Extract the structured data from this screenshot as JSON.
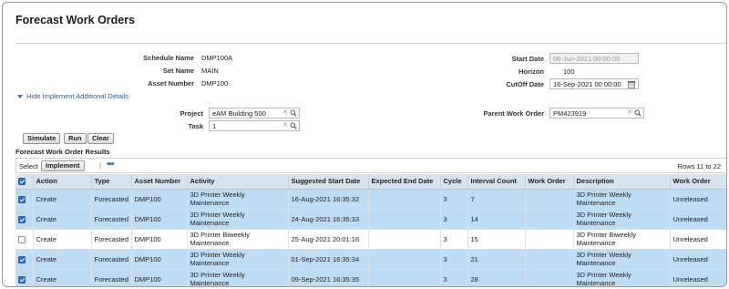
{
  "page": {
    "title": "Forecast Work Orders"
  },
  "header": {
    "schedule_name_label": "Schedule Name",
    "schedule_name": "DMP100A",
    "set_name_label": "Set Name",
    "set_name": "MAIN",
    "asset_number_label": "Asset Number",
    "asset_number": "DMP100",
    "start_date_label": "Start Date",
    "start_date": "08-Jun-2021 00:00:00",
    "horizon_label": "Horizon",
    "horizon": "100",
    "cutoff_date_label": "CutOff Date",
    "cutoff_date": "16-Sep-2021 00:00:00"
  },
  "toggle": {
    "label": "Hide Implement Additional Details"
  },
  "details": {
    "project_label": "Project",
    "project": "eAM Building 500",
    "task_label": "Task",
    "task": "1",
    "parent_wo_label": "Parent Work Order",
    "parent_wo": "PM423919"
  },
  "actions": {
    "simulate": "Simulate",
    "run": "Run",
    "clear": "Clear"
  },
  "results": {
    "section_title": "Forecast Work Order Results",
    "select_label": "Select",
    "implement_label": "Implement",
    "separator": "|",
    "more_glyph": "•••",
    "rows_label": "Rows 11 to 22",
    "columns": [
      "Action",
      "Type",
      "Asset Number",
      "Activity",
      "Suggested Start Date",
      "Expected End Date",
      "Cycle",
      "Interval Count",
      "Work Order",
      "Description",
      "Work Order"
    ],
    "rows": [
      {
        "selected": true,
        "action": "Create",
        "type": "Forecasted",
        "asset": "DMP100",
        "activity": "3D Printer Weekly Maintenance",
        "start": "16-Aug-2021 16:35:32",
        "end": "",
        "cycle": "3",
        "interval": "7",
        "work_order": "",
        "description": "3D Printer Weekly Maintenance",
        "status": "Unreleased"
      },
      {
        "selected": true,
        "action": "Create",
        "type": "Forecasted",
        "asset": "DMP100",
        "activity": "3D Printer Weekly Maintenance",
        "start": "24-Aug-2021 16:35:33",
        "end": "",
        "cycle": "3",
        "interval": "14",
        "work_order": "",
        "description": "3D Printer Weekly Maintenance",
        "status": "Unreleased"
      },
      {
        "selected": false,
        "action": "Create",
        "type": "Forecasted",
        "asset": "DMP100",
        "activity": "3D Printer Biweekly Maintenance",
        "start": "25-Aug-2021 20:01:16",
        "end": "",
        "cycle": "3",
        "interval": "15",
        "work_order": "",
        "description": "3D Printer Biweekly Maintenance",
        "status": "Unreleased"
      },
      {
        "selected": true,
        "action": "Create",
        "type": "Forecasted",
        "asset": "DMP100",
        "activity": "3D Printer Weekly Maintenance",
        "start": "01-Sep-2021 16:35:34",
        "end": "",
        "cycle": "3",
        "interval": "21",
        "work_order": "",
        "description": "3D Printer Weekly Maintenance",
        "status": "Unreleased"
      },
      {
        "selected": true,
        "action": "Create",
        "type": "Forecasted",
        "asset": "DMP100",
        "activity": "3D Printer Weekly Maintenance",
        "start": "09-Sep-2021 16:35:35",
        "end": "",
        "cycle": "3",
        "interval": "28",
        "work_order": "",
        "description": "3D Printer Weekly Maintenance",
        "status": "Unreleased"
      }
    ]
  },
  "icons": {
    "search": "search-icon",
    "calendar": "calendar-icon",
    "clear": "clear-icon",
    "checkbox": "checkbox-icon",
    "disclosure": "triangle-down-icon"
  },
  "colors": {
    "selected_row": "#bfdcf5",
    "header_bg": "#d7e4f0",
    "link": "#1f5fa8",
    "checkbox": "#2f6dc2"
  }
}
